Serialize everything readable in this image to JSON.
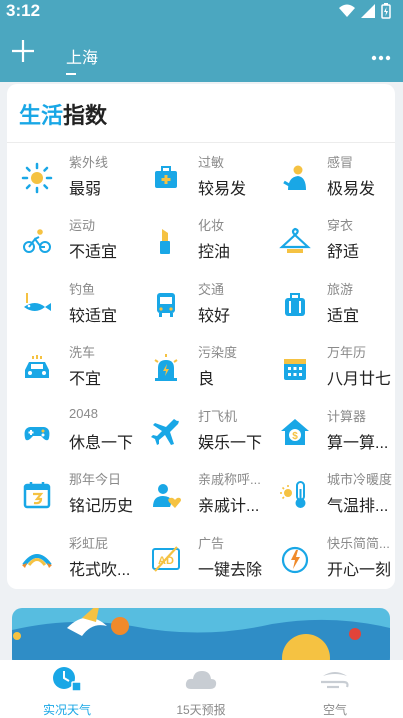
{
  "status_bar": {
    "time": "3:12"
  },
  "app_bar": {
    "city": "上海"
  },
  "card": {
    "title_accent": "生活",
    "title_rest": "指数",
    "items": [
      {
        "label": "紫外线",
        "value": "最弱",
        "icon": "sun-icon"
      },
      {
        "label": "过敏",
        "value": "较易发",
        "icon": "medical-kit-icon"
      },
      {
        "label": "感冒",
        "value": "极易发",
        "icon": "person-cold-icon"
      },
      {
        "label": "运动",
        "value": "不适宜",
        "icon": "cyclist-icon"
      },
      {
        "label": "化妆",
        "value": "控油",
        "icon": "lipstick-icon"
      },
      {
        "label": "穿衣",
        "value": "舒适",
        "icon": "hanger-icon"
      },
      {
        "label": "钓鱼",
        "value": "较适宜",
        "icon": "fish-icon"
      },
      {
        "label": "交通",
        "value": "较好",
        "icon": "bus-icon"
      },
      {
        "label": "旅游",
        "value": "适宜",
        "icon": "luggage-icon"
      },
      {
        "label": "洗车",
        "value": "不宜",
        "icon": "car-icon"
      },
      {
        "label": "污染度",
        "value": "良",
        "icon": "alarm-icon"
      },
      {
        "label": "万年历",
        "value": "八月廿七",
        "icon": "calendar-icon"
      },
      {
        "label": "2048",
        "value": "休息一下",
        "icon": "gamepad-icon"
      },
      {
        "label": "打飞机",
        "value": "娱乐一下",
        "icon": "airplane-icon"
      },
      {
        "label": "计算器",
        "value": "算一算...",
        "icon": "calculator-house-icon"
      },
      {
        "label": "那年今日",
        "value": "铭记历史",
        "icon": "history-calendar-icon"
      },
      {
        "label": "亲戚称呼...",
        "value": "亲戚计...",
        "icon": "relatives-icon"
      },
      {
        "label": "城市冷暖度",
        "value": "气温排...",
        "icon": "thermometer-icon"
      },
      {
        "label": "彩虹屁",
        "value": "花式吹...",
        "icon": "rainbow-icon"
      },
      {
        "label": "广告",
        "value": "一键去除",
        "icon": "no-ad-icon"
      },
      {
        "label": "快乐简简...",
        "value": "开心一刻",
        "icon": "smile-icon"
      }
    ]
  },
  "bottom_nav": [
    {
      "label": "实况天气",
      "active": true
    },
    {
      "label": "15天预报",
      "active": false
    },
    {
      "label": "空气",
      "active": false
    }
  ],
  "colors": {
    "accent": "#19a7e6",
    "header": "#4ba7c0",
    "icon_yellow": "#f5c242"
  }
}
